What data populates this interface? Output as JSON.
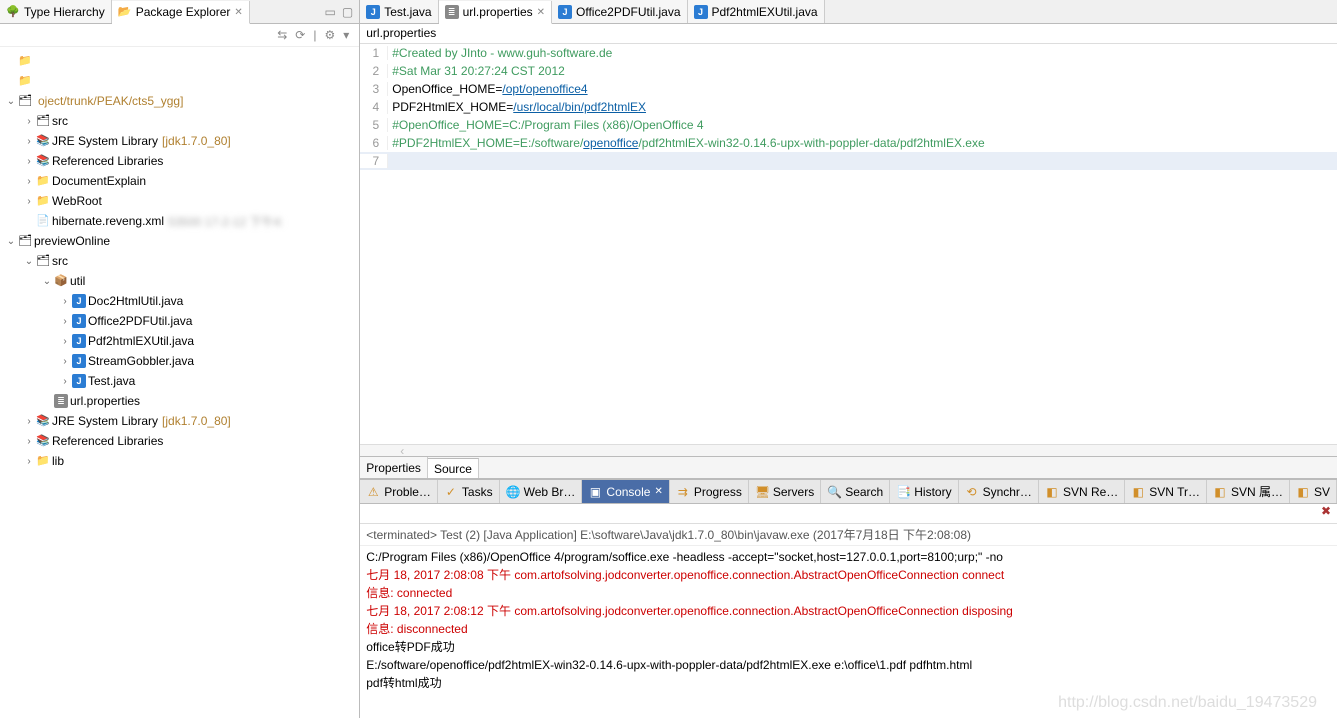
{
  "left": {
    "tabs": [
      {
        "label": "Package Explorer",
        "icon": "📂",
        "active": true
      },
      {
        "label": "Type Hierarchy",
        "icon": "🌳",
        "active": false
      }
    ],
    "toolbar_icons": [
      "⇆",
      "⟳",
      "|",
      "⚙",
      "▾"
    ],
    "tree": [
      {
        "depth": 0,
        "twisty": "",
        "icon": "📁",
        "label": "",
        "blur": true
      },
      {
        "depth": 0,
        "twisty": "",
        "icon": "📁",
        "label": "",
        "blur": true
      },
      {
        "depth": 0,
        "twisty": "⌄",
        "icon": "🗂",
        "label": "",
        "blur": true,
        "decor": "oject/trunk/PEAK/cts5_ygg]"
      },
      {
        "depth": 1,
        "twisty": "›",
        "icon": "🗂",
        "label": "src"
      },
      {
        "depth": 1,
        "twisty": "›",
        "icon": "📚",
        "label": "JRE System Library",
        "decor": "[jdk1.7.0_80]"
      },
      {
        "depth": 1,
        "twisty": "›",
        "icon": "📚",
        "label": "Referenced Libraries"
      },
      {
        "depth": 1,
        "twisty": "›",
        "icon": "📁",
        "label": "DocumentExplain"
      },
      {
        "depth": 1,
        "twisty": "›",
        "icon": "📁",
        "label": "WebRoot"
      },
      {
        "depth": 1,
        "twisty": "",
        "icon": "📄",
        "label": "hibernate.reveng.xml",
        "decor": "53500  17-2-12 下午4:",
        "blur_decor": true
      },
      {
        "depth": 0,
        "twisty": "⌄",
        "icon": "🗂",
        "label": "previewOnline"
      },
      {
        "depth": 1,
        "twisty": "⌄",
        "icon": "🗂",
        "label": "src"
      },
      {
        "depth": 2,
        "twisty": "⌄",
        "icon": "📦",
        "label": "util"
      },
      {
        "depth": 3,
        "twisty": "›",
        "icon": "J",
        "label": "Doc2HtmlUtil.java"
      },
      {
        "depth": 3,
        "twisty": "›",
        "icon": "J",
        "label": "Office2PDFUtil.java"
      },
      {
        "depth": 3,
        "twisty": "›",
        "icon": "J",
        "label": "Pdf2htmlEXUtil.java"
      },
      {
        "depth": 3,
        "twisty": "›",
        "icon": "J",
        "label": "StreamGobbler.java"
      },
      {
        "depth": 3,
        "twisty": "›",
        "icon": "J",
        "label": "Test.java"
      },
      {
        "depth": 2,
        "twisty": "",
        "icon": "≣",
        "label": "url.properties"
      },
      {
        "depth": 1,
        "twisty": "›",
        "icon": "📚",
        "label": "JRE System Library",
        "decor": "[jdk1.7.0_80]"
      },
      {
        "depth": 1,
        "twisty": "›",
        "icon": "📚",
        "label": "Referenced Libraries"
      },
      {
        "depth": 1,
        "twisty": "›",
        "icon": "📁",
        "label": "lib"
      }
    ]
  },
  "editor": {
    "tabs": [
      {
        "icon": "J",
        "label": "Test.java",
        "active": false
      },
      {
        "icon": "≣",
        "label": "url.properties",
        "active": true,
        "close": true
      },
      {
        "icon": "J",
        "label": "Office2PDFUtil.java",
        "active": false
      },
      {
        "icon": "J",
        "label": "Pdf2htmlEXUtil.java",
        "active": false
      }
    ],
    "breadcrumb": "url.properties",
    "lines": [
      {
        "n": 1,
        "segs": [
          {
            "t": "#Created by JInto - www.guh-software.de",
            "cls": "comment"
          }
        ]
      },
      {
        "n": 2,
        "segs": [
          {
            "t": "#Sat Mar 31 20:27:24 CST 2012",
            "cls": "comment"
          }
        ]
      },
      {
        "n": 3,
        "segs": [
          {
            "t": "OpenOffice_HOME=",
            "cls": "key"
          },
          {
            "t": "/opt/openoffice4",
            "cls": "url"
          }
        ]
      },
      {
        "n": 4,
        "segs": [
          {
            "t": "PDF2HtmlEX_HOME=",
            "cls": "key"
          },
          {
            "t": "/usr/local/bin/pdf2htmlEX",
            "cls": "url"
          }
        ]
      },
      {
        "n": 5,
        "segs": [
          {
            "t": "#OpenOffice_HOME=C:/Program Files (x86)/OpenOffice 4",
            "cls": "comment"
          }
        ]
      },
      {
        "n": 6,
        "segs": [
          {
            "t": "#PDF2HtmlEX_HOME=E:/software/",
            "cls": "comment"
          },
          {
            "t": "openoffice",
            "cls": "comment url"
          },
          {
            "t": "/pdf2htmlEX-win32-0.14.6-upx-with-poppler-data/pdf2htmlEX.exe",
            "cls": "comment"
          }
        ]
      },
      {
        "n": 7,
        "segs": [
          {
            "t": "",
            "cls": ""
          }
        ],
        "current": true
      }
    ],
    "bottom_tabs": [
      {
        "label": "Properties",
        "active": false
      },
      {
        "label": "Source",
        "active": true
      }
    ],
    "ruler_hint": "‹"
  },
  "bottom": {
    "view_tabs": [
      {
        "icon": "⚠",
        "label": "Proble…"
      },
      {
        "icon": "✓",
        "label": "Tasks"
      },
      {
        "icon": "🌐",
        "label": "Web Br…"
      },
      {
        "icon": "▣",
        "label": "Console",
        "active": true,
        "close": true
      },
      {
        "icon": "⇉",
        "label": "Progress"
      },
      {
        "icon": "🖥",
        "label": "Servers"
      },
      {
        "icon": "🔍",
        "label": "Search"
      },
      {
        "icon": "📑",
        "label": "History"
      },
      {
        "icon": "⟲",
        "label": "Synchr…"
      },
      {
        "icon": "◧",
        "label": "SVN Re…"
      },
      {
        "icon": "◧",
        "label": "SVN Tr…"
      },
      {
        "icon": "◧",
        "label": "SVN 属…"
      },
      {
        "icon": "◧",
        "label": "SV"
      }
    ],
    "toolbar_warn": "✖",
    "header": "<terminated> Test (2) [Java Application] E:\\software\\Java\\jdk1.7.0_80\\bin\\javaw.exe (2017年7月18日 下午2:08:08)",
    "lines": [
      {
        "t": "C:/Program Files (x86)/OpenOffice 4/program/soffice.exe -headless -accept=\"socket,host=127.0.0.1,port=8100;urp;\" -no",
        "cls": ""
      },
      {
        "t": "七月 18, 2017 2:08:08 下午 com.artofsolving.jodconverter.openoffice.connection.AbstractOpenOfficeConnection connect",
        "cls": "cred"
      },
      {
        "t": "信息: connected",
        "cls": "cred"
      },
      {
        "t": "七月 18, 2017 2:08:12 下午 com.artofsolving.jodconverter.openoffice.connection.AbstractOpenOfficeConnection disposing",
        "cls": "cred"
      },
      {
        "t": "信息: disconnected",
        "cls": "cred"
      },
      {
        "t": "office转PDF成功",
        "cls": ""
      },
      {
        "t": "E:/software/openoffice/pdf2htmlEX-win32-0.14.6-upx-with-poppler-data/pdf2htmlEX.exe e:\\office\\1.pdf pdfhtm.html",
        "cls": ""
      },
      {
        "t": "pdf转html成功",
        "cls": ""
      }
    ]
  },
  "watermark": "http://blog.csdn.net/baidu_19473529"
}
